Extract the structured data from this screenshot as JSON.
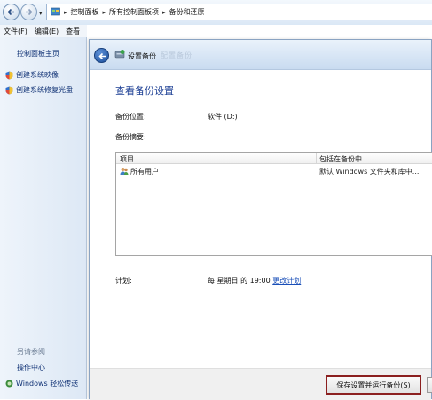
{
  "address_bar": {
    "breadcrumb": [
      "控制面板",
      "所有控制面板项",
      "备份和还原"
    ]
  },
  "menu": {
    "items": [
      "文件(F)",
      "编辑(E)",
      "查看"
    ]
  },
  "left_pane": {
    "home": "控制面板主页",
    "tasks": [
      "创建系统映像",
      "创建系统修复光盘"
    ],
    "see_also_title": "另请参阅",
    "see_also": [
      "操作中心",
      "Windows 轻松传送"
    ]
  },
  "wizard": {
    "title": "设置备份",
    "ghost_title": "配置备份",
    "heading": "查看备份设置",
    "location_label": "备份位置:",
    "location_value": "软件 (D:)",
    "summary_label": "备份摘要:",
    "list": {
      "col_item": "项目",
      "col_included": "包括在备份中",
      "rows": [
        {
          "item": "所有用户",
          "included": "默认 Windows 文件夹和库中..."
        }
      ]
    },
    "schedule_label": "计划:",
    "schedule_value": "每 星期日 的 19:00",
    "schedule_link": "更改计划",
    "save_button": "保存设置并运行备份(S)"
  },
  "colors": {
    "heading": "#1c3f94",
    "link": "#1a4fb8",
    "highlight_border": "#8b1f1f"
  },
  "icons": [
    "back-arrow-icon",
    "forward-arrow-icon",
    "control-panel-icon",
    "shield-icon",
    "backup-icon",
    "users-icon",
    "transfer-icon"
  ]
}
